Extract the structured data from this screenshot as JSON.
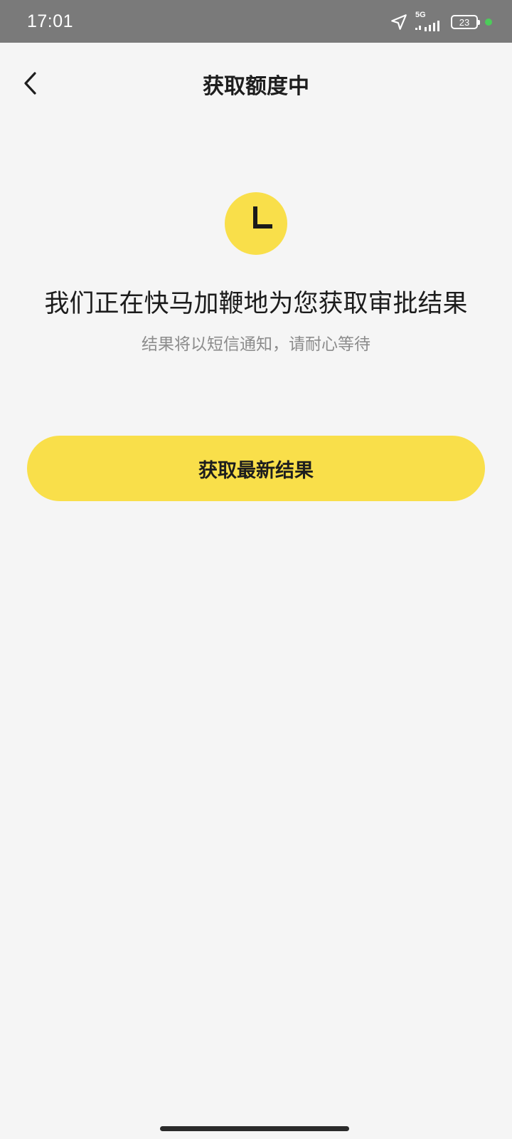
{
  "status_bar": {
    "time": "17:01",
    "network": "5G",
    "battery": "23",
    "icons": [
      "location-arrow-icon",
      "signal-icon",
      "battery-icon",
      "status-dot"
    ]
  },
  "header": {
    "title": "获取额度中",
    "back_icon": "chevron-left-icon"
  },
  "status_icon": "clock-icon",
  "message": {
    "main": "我们正在快马加鞭地为您获取审批结果",
    "sub": "结果将以短信通知，请耐心等待"
  },
  "actions": {
    "refresh_label": "获取最新结果"
  },
  "colors": {
    "accent": "#f9df4a",
    "status_bar": "#7a7a7a",
    "background": "#f5f5f5",
    "title_text": "#1e1e1e",
    "sub_text": "#8c8c8c",
    "status_dot": "#4ccc5a"
  }
}
